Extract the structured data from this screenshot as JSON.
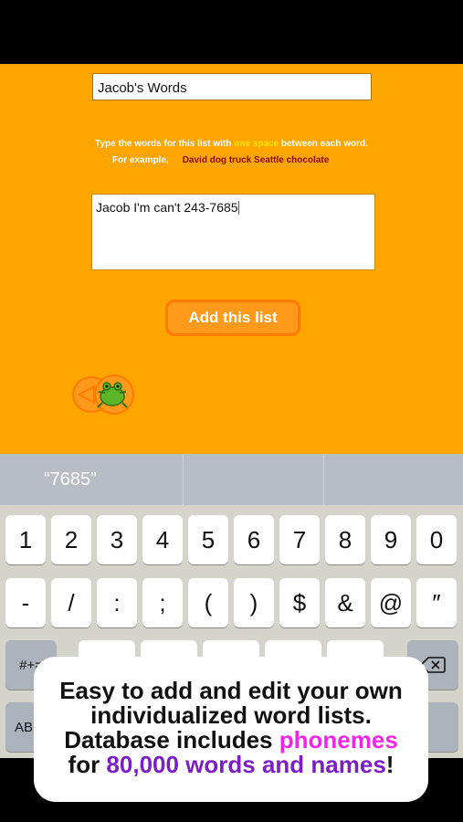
{
  "list_name": {
    "value": "Jacob's Words"
  },
  "instructions": {
    "before": "Type the words for this list with ",
    "highlight": "one space",
    "after": " between each word.",
    "example_label": "For example,",
    "example_words": "David dog truck Seattle chocolate"
  },
  "words_input": {
    "value": "Jacob I'm can't 243-7685"
  },
  "add_button": {
    "label": "Add this list"
  },
  "back_button": {
    "icon": "frog-back-icon"
  },
  "suggestions": [
    "“7685”",
    "",
    ""
  ],
  "keyboard": {
    "row1": [
      "1",
      "2",
      "3",
      "4",
      "5",
      "6",
      "7",
      "8",
      "9",
      "0"
    ],
    "row2": [
      "-",
      "/",
      ":",
      ";",
      "(",
      ")",
      "$",
      "&",
      "@",
      "″"
    ],
    "symbols_key": "#+=",
    "abc_key": "AB",
    "delete_icon": "backspace-icon"
  },
  "promo": {
    "line1": "Easy to add and edit your own",
    "line2": "individualized word lists.",
    "line3_a": "Database includes ",
    "line3_b": "phonemes",
    "line4_a": "for ",
    "line4_b": "80,000 words and names",
    "line4_c": "!"
  },
  "colors": {
    "app_bg": "#FFA500",
    "button_border": "#FF7A00",
    "example_words": "#8B0A00",
    "highlight_yellow": "#FFE600",
    "promo_magenta": "#F226E6",
    "promo_purple": "#7A1FC4"
  }
}
